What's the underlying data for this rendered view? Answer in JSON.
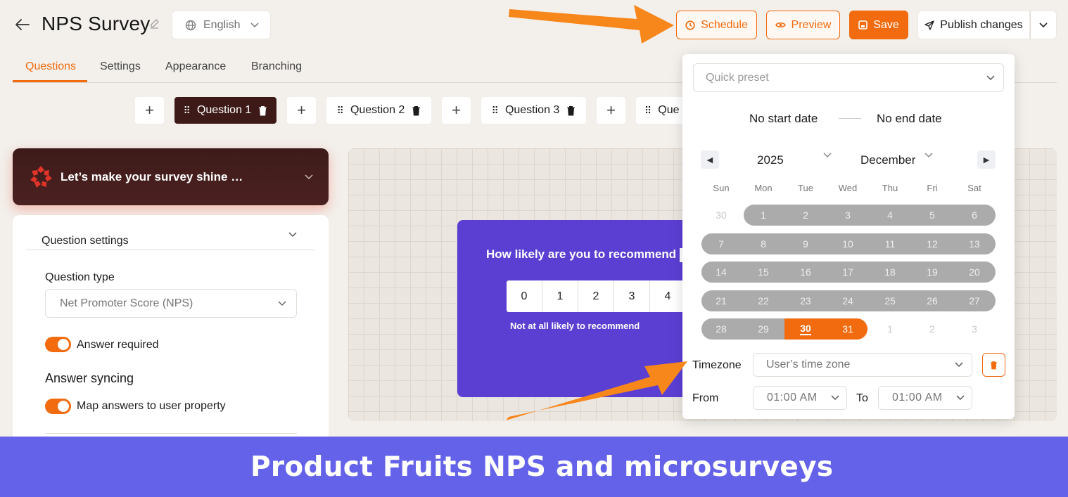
{
  "header": {
    "title": "NPS Survey",
    "language": "English",
    "schedule_label": "Schedule",
    "preview_label": "Preview",
    "save_label": "Save",
    "publish_label": "Publish changes"
  },
  "tabs": [
    {
      "label": "Questions",
      "active": true
    },
    {
      "label": "Settings",
      "active": false
    },
    {
      "label": "Appearance",
      "active": false
    },
    {
      "label": "Branching",
      "active": false
    }
  ],
  "question_strip": {
    "items": [
      "Question 1",
      "Question 2",
      "Question 3",
      "Que"
    ],
    "active_index": 0
  },
  "left_panel": {
    "banner": "Let’s make your survey shine …",
    "section_title": "Question settings",
    "question_type_label": "Question type",
    "question_type_value": "Net Promoter Score (NPS)",
    "answer_required_label": "Answer required",
    "answer_syncing_title": "Answer syncing",
    "map_answers_label": "Map answers to user property"
  },
  "preview": {
    "question": "How likely are you to recommend",
    "scale": [
      "0",
      "1",
      "2",
      "3",
      "4"
    ],
    "low_label": "Not at all likely to recommend"
  },
  "schedule": {
    "preset_placeholder": "Quick preset",
    "start": "No start date",
    "end": "No end date",
    "year": "2025",
    "month": "December",
    "weekdays": [
      "Sun",
      "Mon",
      "Tue",
      "Wed",
      "Thu",
      "Fri",
      "Sat"
    ],
    "weeks": [
      [
        "30",
        "1",
        "2",
        "3",
        "4",
        "5",
        "6"
      ],
      [
        "7",
        "8",
        "9",
        "10",
        "11",
        "12",
        "13"
      ],
      [
        "14",
        "15",
        "16",
        "17",
        "18",
        "19",
        "20"
      ],
      [
        "21",
        "22",
        "23",
        "24",
        "25",
        "26",
        "27"
      ],
      [
        "28",
        "29",
        "30",
        "31",
        "1",
        "2",
        "3"
      ]
    ],
    "selected_days": [
      "30",
      "31"
    ],
    "today": "30",
    "timezone_label": "Timezone",
    "timezone_value": "User’s time zone",
    "from_label": "From",
    "from_value": "01:00 AM",
    "to_label": "To",
    "to_value": "01:00 AM"
  },
  "footer_banner": "Product Fruits NPS and microsurveys",
  "colors": {
    "accent": "#f26b0f",
    "dark_brand": "#3d1a18",
    "nps_card": "#5b3fd3",
    "banner": "#6462e8",
    "arrow": "#f7861b"
  }
}
